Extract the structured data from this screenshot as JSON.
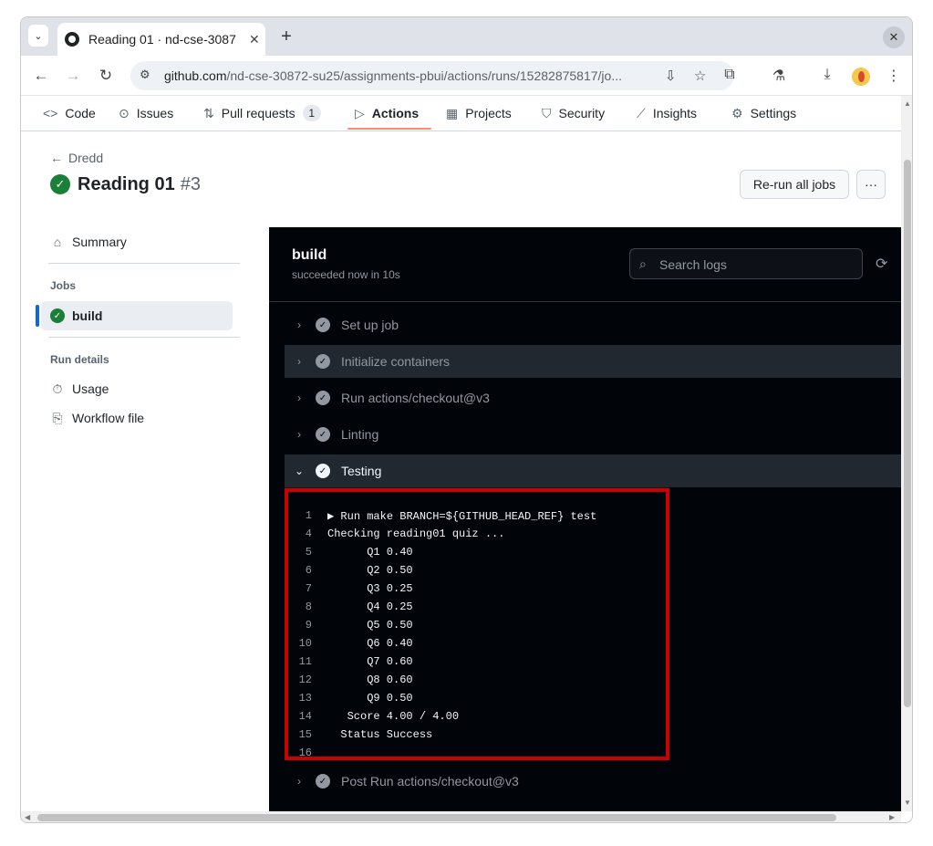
{
  "browser": {
    "tab_title": "Reading 01 · nd-cse-3087",
    "tab_close": "✕",
    "new_tab": "+",
    "tab_search": "⌄",
    "window_menu": "✕",
    "url_host": "github.com",
    "url_path": "/nd-cse-30872-su25/assignments-pbui/actions/runs/15282875817/jo...",
    "icons": [
      "back-icon",
      "forward-icon",
      "reload-icon",
      "site-info-icon",
      "install-icon",
      "star-icon",
      "extensions-icon",
      "labs-icon",
      "download-icon",
      "profile-icon",
      "menu-icon"
    ]
  },
  "repo_nav": {
    "items": [
      {
        "label": "Code",
        "icon": "code-icon"
      },
      {
        "label": "Issues",
        "icon": "issue-icon"
      },
      {
        "label": "Pull requests",
        "icon": "pull-request-icon",
        "count": "1"
      },
      {
        "label": "Actions",
        "icon": "play-icon",
        "active": true
      },
      {
        "label": "Projects",
        "icon": "table-icon"
      },
      {
        "label": "Security",
        "icon": "shield-icon"
      },
      {
        "label": "Insights",
        "icon": "graph-icon"
      },
      {
        "label": "Settings",
        "icon": "gear-icon"
      }
    ]
  },
  "header": {
    "back_label": "Dredd",
    "title": "Reading 01",
    "run_number": "#3",
    "rerun_label": "Re-run all jobs",
    "more_label": "···"
  },
  "sidebar": {
    "summary": "Summary",
    "jobs_heading": "Jobs",
    "job": "build",
    "run_details_heading": "Run details",
    "usage": "Usage",
    "workflow_file": "Workflow file"
  },
  "job": {
    "name": "build",
    "status": "succeeded now in 10s",
    "search_placeholder": "Search logs",
    "steps": [
      {
        "label": "Set up job"
      },
      {
        "label": "Initialize containers"
      },
      {
        "label": "Run actions/checkout@v3"
      },
      {
        "label": "Linting"
      },
      {
        "label": "Testing",
        "expanded": true
      },
      {
        "label": "Post Run actions/checkout@v3"
      }
    ],
    "log_lines": [
      {
        "n": "1",
        "text": "▶ Run make BRANCH=${GITHUB_HEAD_REF} test"
      },
      {
        "n": "4",
        "text": "Checking reading01 quiz ..."
      },
      {
        "n": "5",
        "text": "      Q1 0.40"
      },
      {
        "n": "6",
        "text": "      Q2 0.50"
      },
      {
        "n": "7",
        "text": "      Q3 0.25"
      },
      {
        "n": "8",
        "text": "      Q4 0.25"
      },
      {
        "n": "9",
        "text": "      Q5 0.50"
      },
      {
        "n": "10",
        "text": "      Q6 0.40"
      },
      {
        "n": "11",
        "text": "      Q7 0.60"
      },
      {
        "n": "12",
        "text": "      Q8 0.60"
      },
      {
        "n": "13",
        "text": "      Q9 0.50"
      },
      {
        "n": "14",
        "text": "   Score 4.00 / 4.00"
      },
      {
        "n": "15",
        "text": "  Status Success"
      },
      {
        "n": "16",
        "text": ""
      }
    ]
  },
  "colors": {
    "success": "#1a7f37",
    "accent_underline": "#fd8c73",
    "log_bg": "#010409",
    "highlight_box": "#cc0000"
  }
}
